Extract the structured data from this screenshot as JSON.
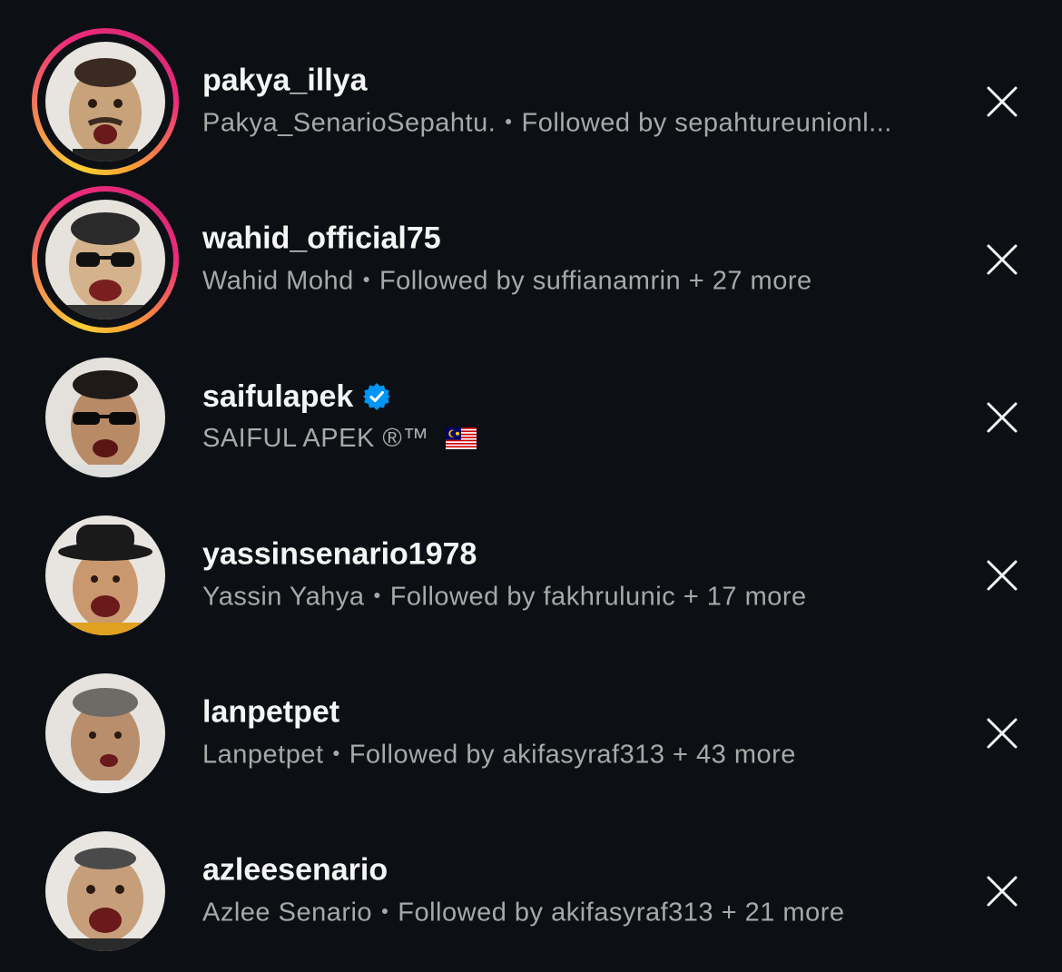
{
  "suggestions": [
    {
      "username": "pakya_illya",
      "display_name": "Pakya_SenarioSepahtu.",
      "followed_by": "Followed by sepahtureunionl...",
      "has_story": true,
      "verified": false,
      "avatar_color": "#c8a27a"
    },
    {
      "username": "wahid_official75",
      "display_name": "Wahid Mohd",
      "followed_by": "Followed by suffianamrin + 27 more",
      "has_story": true,
      "verified": false,
      "avatar_color": "#d4b28c"
    },
    {
      "username": "saifulapek",
      "display_name": "SAIFUL APEK ®™",
      "followed_by": "",
      "has_story": false,
      "verified": true,
      "flag": "malaysia-flag-icon",
      "avatar_color": "#b88a66"
    },
    {
      "username": "yassinsenario1978",
      "display_name": "Yassin Yahya",
      "followed_by": "Followed by fakhrulunic + 17 more",
      "has_story": false,
      "verified": false,
      "avatar_color": "#c9986e"
    },
    {
      "username": "lanpetpet",
      "display_name": "Lanpetpet",
      "followed_by": "Followed by akifasyraf313 + 43 more",
      "has_story": false,
      "verified": false,
      "avatar_color": "#b98e6c"
    },
    {
      "username": "azleesenario",
      "display_name": "Azlee Senario",
      "followed_by": "Followed by akifasyraf313 + 21 more",
      "has_story": false,
      "verified": false,
      "avatar_color": "#c79e7a"
    }
  ],
  "icons": {
    "dismiss": "close-icon",
    "verified": "verified-badge-icon"
  },
  "colors": {
    "background": "#0c1014",
    "primary_text": "#f5f5f5",
    "secondary_text": "#a8a8a8",
    "verified_blue": "#0095f6"
  }
}
